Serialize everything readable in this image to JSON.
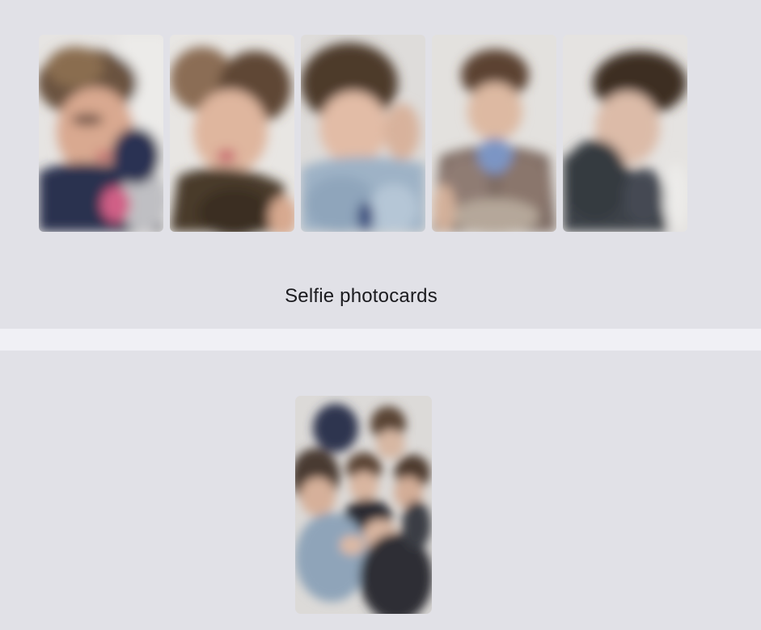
{
  "selfie_section": {
    "caption": "Selfie photocards",
    "cards": [
      {
        "subject": "selfie-photocard-1"
      },
      {
        "subject": "selfie-photocard-2"
      },
      {
        "subject": "selfie-photocard-3"
      },
      {
        "subject": "selfie-photocard-4"
      },
      {
        "subject": "selfie-photocard-5"
      }
    ]
  },
  "group_section": {
    "cards": [
      {
        "subject": "group-photocard"
      }
    ]
  }
}
